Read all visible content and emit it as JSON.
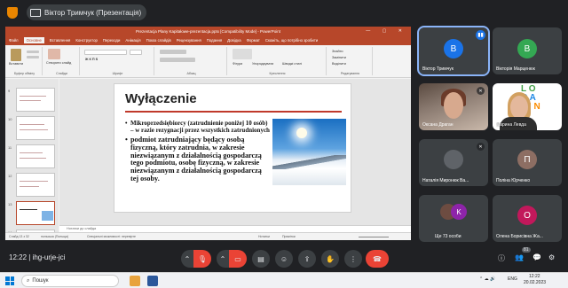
{
  "meeting": {
    "presentation_label": "Віктор Тримчук (Презентація)",
    "time": "12:22",
    "code": "ihg-urje-jci"
  },
  "ppt": {
    "doc_title": "Prezentacja Plany Kapitałowe-prezentacja.pptx [Compatibility Mode] - PowerPoint",
    "menu": [
      "Файл",
      "Основне",
      "Вставлення",
      "Конструктор",
      "Переходи",
      "Анімація",
      "Показ слайдів",
      "Рецензування",
      "Подання",
      "Довідка",
      "Формат",
      "Скажіть, що потрібно зробити"
    ],
    "active_menu_index": 1,
    "ribbon_groups": [
      "Буфер обміну",
      "Слайди",
      "Шрифт",
      "Абзац",
      "Креслення",
      "Редагування"
    ],
    "ribbon_buttons": {
      "paste": "Вставити",
      "new_slide": "Створити слайд",
      "shapes": "Фігури",
      "arrange": "Упорядкувати",
      "quick_styles": "Швидкі стилі",
      "find": "Знайти",
      "replace": "Замінити",
      "select": "Виділити"
    },
    "thumbnail_numbers": [
      "9",
      "10",
      "11",
      "12",
      "13",
      "14"
    ],
    "selected_thumbnail": 4,
    "notes_placeholder": "Нотатки до слайда",
    "status": {
      "slide_info": "Слайд 13 з 32",
      "language": "польська (Польща)",
      "accessibility": "Спеціальні можливості: перевірте",
      "notes_btn": "Нотатки",
      "comments_btn": "Примітки"
    }
  },
  "slide": {
    "title": "Wyłączenie",
    "bullet1": "Mikroprzedsiębiorcy (zatrudnienie poniżej 10 osób) – w razie rezygnacji przez wszystkich zatrudnionych",
    "bullet2": "podmiot zatrudniający będący osobą fizyczną, który zatrudnia, w zakresie niezwiązanym z działalnością gospodarczą tego podmiotu, osobę fizyczną, w zakresie niezwiązanym z działalnością gospodarczą tej osoby.",
    "bullet_char": "•"
  },
  "participants": [
    {
      "name": "Віктор Тримчук",
      "initial": "В",
      "color": "#1a73e8",
      "speaking": true
    },
    {
      "name": "Вікторія Марценюк",
      "initial": "В",
      "color": "#34a853"
    },
    {
      "name": "Оксана Драган",
      "initial": ""
    },
    {
      "name": "Марина Левда",
      "initial": ""
    },
    {
      "name": "Наталія Миронюк Ва...",
      "initial": ""
    },
    {
      "name": "Поліна Юрченко",
      "initial": "П",
      "color": "#8d6e63"
    },
    {
      "name": "Ще 73 особи",
      "initial": "K",
      "color": "#8e24aa"
    },
    {
      "name": "Олена Борисівна Жа...",
      "initial": "О",
      "color": "#c2185b"
    }
  ],
  "logo_text": "LOCAL FINANCE",
  "taskbar": {
    "search_placeholder": "Пошук",
    "lang": "ENG",
    "clock_time": "12:22",
    "clock_date": "20.02.2023",
    "participants_count": "81"
  }
}
